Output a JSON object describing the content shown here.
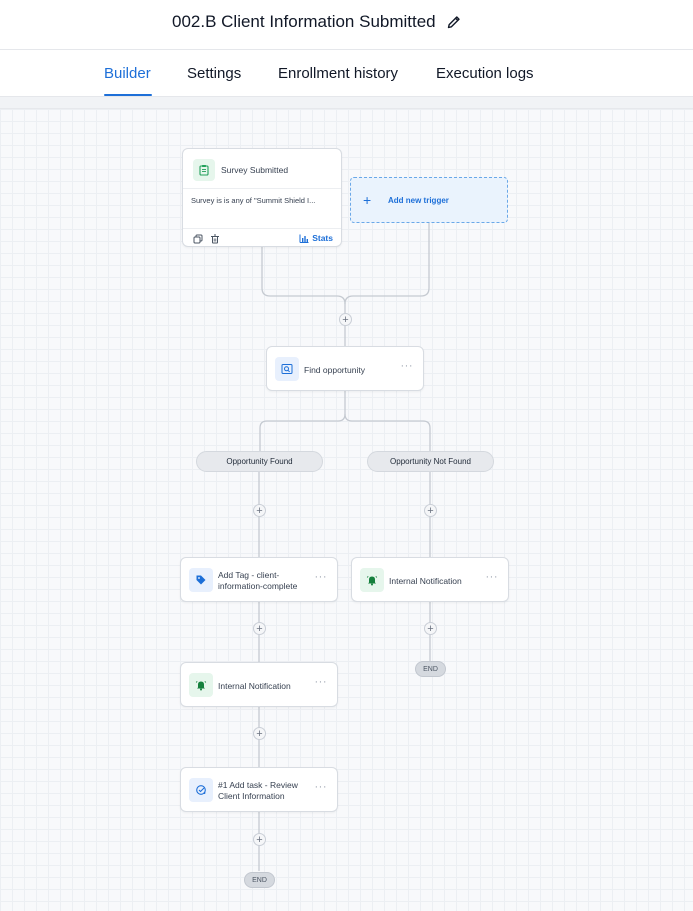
{
  "header": {
    "title": "002.B Client Information Submitted",
    "edit_icon": "pencil-icon"
  },
  "tabs": [
    {
      "label": "Builder",
      "active": true
    },
    {
      "label": "Settings",
      "active": false
    },
    {
      "label": "Enrollment history",
      "active": false
    },
    {
      "label": "Execution logs",
      "active": false
    }
  ],
  "colors": {
    "accent": "#1d6fd8",
    "trigger_icon": "#22a05a",
    "action_icon": "#1d6fd8"
  },
  "workflow": {
    "trigger": {
      "title": "Survey Submitted",
      "condition": "Survey is is any of \"Summit Shield I...",
      "stats_label": "Stats",
      "icon": "clipboard-icon"
    },
    "add_trigger": {
      "label": "Add new trigger"
    },
    "find_opportunity": {
      "label": "Find opportunity",
      "icon": "search-icon"
    },
    "branches": {
      "found": {
        "label": "Opportunity Found",
        "steps": [
          {
            "label": "Add Tag - client-information-complete",
            "line1": "Add Tag - client-",
            "line2": "information-complete",
            "icon": "tag-icon"
          },
          {
            "label": "Internal Notification",
            "icon": "bell-icon"
          },
          {
            "label": "#1 Add task - Review Client Information",
            "line1": "#1 Add task - Review",
            "line2": "Client Information",
            "icon": "task-icon"
          }
        ],
        "end_label": "END"
      },
      "not_found": {
        "label": "Opportunity Not Found",
        "steps": [
          {
            "label": "Internal Notification",
            "icon": "bell-icon"
          }
        ],
        "end_label": "END"
      }
    }
  }
}
